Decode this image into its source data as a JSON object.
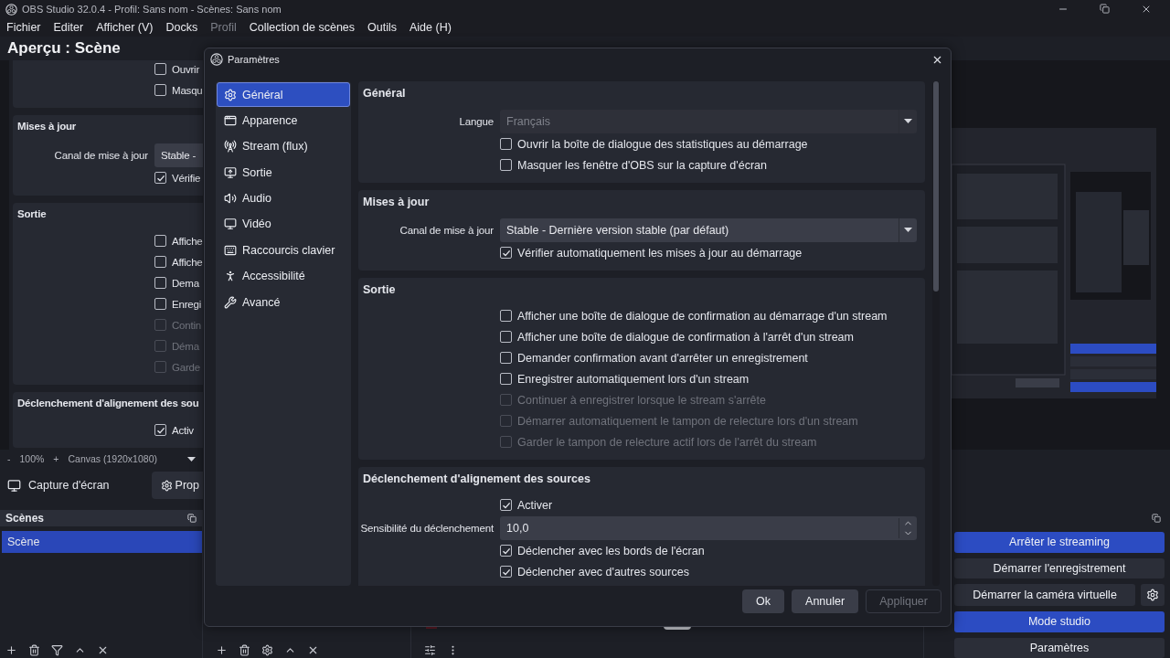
{
  "window": {
    "title": "OBS Studio 32.0.4 - Profil: Sans nom - Scènes: Sans nom"
  },
  "menu": [
    {
      "label": "Fichier",
      "disabled": false
    },
    {
      "label": "Editer",
      "disabled": false
    },
    {
      "label": "Afficher (V)",
      "disabled": false
    },
    {
      "label": "Docks",
      "disabled": false
    },
    {
      "label": "Profil",
      "disabled": true
    },
    {
      "label": "Collection de scènes",
      "disabled": false
    },
    {
      "label": "Outils",
      "disabled": false
    },
    {
      "label": "Aide (H)",
      "disabled": false
    }
  ],
  "preview": {
    "title": "Aperçu : Scène",
    "mirror_sections": [
      {
        "rows": [
          {
            "kind": "checkbox",
            "label": "Ouvrir",
            "checked": false,
            "disabled": false
          },
          {
            "kind": "checkbox",
            "label": "Masqu",
            "checked": false,
            "disabled": false
          }
        ]
      },
      {
        "title": "Mises à jour",
        "rows": [
          {
            "kind": "select",
            "label": "Canal de mise à jour",
            "value": "Stable -",
            "disabled": false
          },
          {
            "kind": "checkbox",
            "label": "Vérifie",
            "checked": true,
            "disabled": false
          }
        ]
      },
      {
        "title": "Sortie",
        "rows": [
          {
            "kind": "checkbox",
            "label": "Affiche",
            "checked": false,
            "disabled": false
          },
          {
            "kind": "checkbox",
            "label": "Affiche",
            "checked": false,
            "disabled": false
          },
          {
            "kind": "checkbox",
            "label": "Dema",
            "checked": false,
            "disabled": false
          },
          {
            "kind": "checkbox",
            "label": "Enregi",
            "checked": false,
            "disabled": false
          },
          {
            "kind": "checkbox",
            "label": "Contin",
            "checked": false,
            "disabled": true
          },
          {
            "kind": "checkbox",
            "label": "Déma",
            "checked": false,
            "disabled": true
          },
          {
            "kind": "checkbox",
            "label": "Garde",
            "checked": false,
            "disabled": true
          }
        ]
      },
      {
        "title": "Déclenchement d'alignement des sou",
        "rows": [
          {
            "kind": "checkbox",
            "label": "Activ",
            "checked": true,
            "disabled": false
          }
        ]
      }
    ]
  },
  "zoom_bar": {
    "zoom_out": "-",
    "zoom": "100%",
    "zoom_in": "+",
    "canvas": "Canvas (1920x1080)"
  },
  "source_bar": {
    "source": "Capture d'écran",
    "properties": "Prop"
  },
  "scenes_dock": {
    "title": "Scènes",
    "items": [
      {
        "label": "Scène",
        "selected": true
      }
    ]
  },
  "mixer": {
    "level": 1
  },
  "controls_dock": {
    "buttons": [
      {
        "kind": "button",
        "label": "Arrêter le streaming",
        "active": true
      },
      {
        "kind": "button",
        "label": "Démarrer l'enregistrement",
        "active": false
      },
      {
        "kind": "with_settings",
        "label": "Démarrer la caméra virtuelle",
        "active": false
      },
      {
        "kind": "button",
        "label": "Mode studio",
        "active": true
      },
      {
        "kind": "button",
        "label": "Paramètres",
        "active": false
      }
    ]
  },
  "settings": {
    "title": "Paramètres",
    "nav": [
      {
        "label": "Général",
        "selected": true
      },
      {
        "label": "Apparence",
        "selected": false
      },
      {
        "label": "Stream (flux)",
        "selected": false
      },
      {
        "label": "Sortie",
        "selected": false
      },
      {
        "label": "Audio",
        "selected": false
      },
      {
        "label": "Vidéo",
        "selected": false
      },
      {
        "label": "Raccourcis clavier",
        "selected": false
      },
      {
        "label": "Accessibilité",
        "selected": false
      },
      {
        "label": "Avancé",
        "selected": false
      }
    ],
    "sections": [
      {
        "title": "Général",
        "rows": [
          {
            "kind": "select",
            "label": "Langue",
            "value": "Français",
            "disabled": true
          },
          {
            "kind": "checkbox",
            "label": "Ouvrir la boîte de dialogue des statistiques au démarrage",
            "checked": false,
            "disabled": false
          },
          {
            "kind": "checkbox",
            "label": "Masquer les fenêtre d'OBS sur la capture d'écran",
            "checked": false,
            "disabled": false
          }
        ]
      },
      {
        "title": "Mises à jour",
        "rows": [
          {
            "kind": "select",
            "label": "Canal de mise à jour",
            "value": "Stable - Dernière version stable (par défaut)",
            "disabled": false
          },
          {
            "kind": "checkbox",
            "label": "Vérifier automatiquement les mises à jour au démarrage",
            "checked": true,
            "disabled": false
          }
        ]
      },
      {
        "title": "Sortie",
        "rows": [
          {
            "kind": "checkbox",
            "label": "Afficher une boîte de dialogue de confirmation au démarrage d'un stream",
            "checked": false,
            "disabled": false
          },
          {
            "kind": "checkbox",
            "label": "Afficher une boîte de dialogue de confirmation à l'arrêt d'un stream",
            "checked": false,
            "disabled": false
          },
          {
            "kind": "checkbox",
            "label": "Demander confirmation avant d'arrêter un enregistrement",
            "checked": false,
            "disabled": false
          },
          {
            "kind": "checkbox",
            "label": "Enregistrer automatiquement lors d'un stream",
            "checked": false,
            "disabled": false
          },
          {
            "kind": "checkbox",
            "label": "Continuer à enregistrer lorsque le stream s'arrête",
            "checked": false,
            "disabled": true
          },
          {
            "kind": "checkbox",
            "label": "Démarrer automatiquement le tampon de relecture lors d'un stream",
            "checked": false,
            "disabled": true
          },
          {
            "kind": "checkbox",
            "label": "Garder le tampon de relecture actif lors de l'arrêt du stream",
            "checked": false,
            "disabled": true
          }
        ]
      },
      {
        "title": "Déclenchement d'alignement des sources",
        "rows": [
          {
            "kind": "checkbox",
            "label": "Activer",
            "checked": true,
            "disabled": false
          },
          {
            "kind": "spin",
            "label": "Sensibilité du déclenchement",
            "value": "10,0"
          },
          {
            "kind": "checkbox",
            "label": "Déclencher avec les bords de l'écran",
            "checked": true,
            "disabled": false
          },
          {
            "kind": "checkbox",
            "label": "Déclencher avec d'autres sources",
            "checked": true,
            "disabled": false
          }
        ]
      }
    ],
    "buttons": [
      {
        "label": "Ok",
        "disabled": false
      },
      {
        "label": "Annuler",
        "disabled": false
      },
      {
        "label": "Appliquer",
        "disabled": true
      }
    ]
  }
}
